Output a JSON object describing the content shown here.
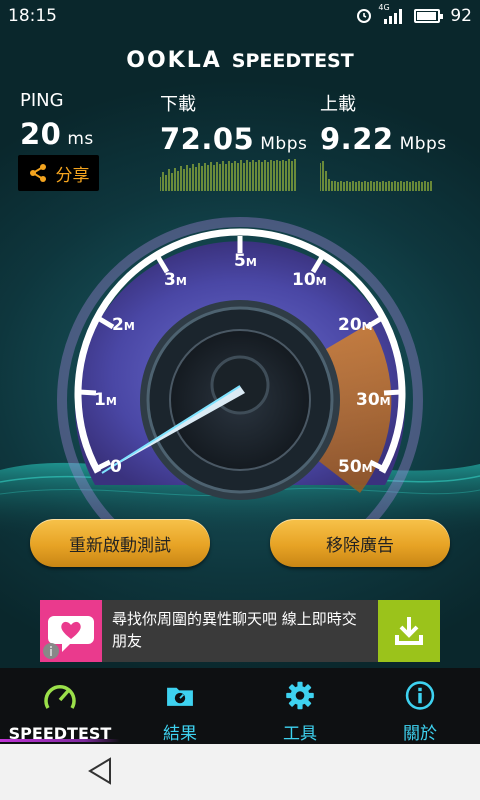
{
  "status": {
    "time": "18:15",
    "network_label": "4G",
    "battery": "92",
    "battery_level": 0.92
  },
  "header": {
    "brand": "OOKLA",
    "product": "SPEEDTEST"
  },
  "stats": {
    "ping": {
      "label": "PING",
      "value": "20",
      "unit": "ms"
    },
    "download": {
      "label": "下載",
      "value": "72.05",
      "unit": "Mbps"
    },
    "upload": {
      "label": "上載",
      "value": "9.22",
      "unit": "Mbps"
    }
  },
  "share": {
    "label": "分享"
  },
  "gauge": {
    "ticks": [
      "0",
      "1",
      "2",
      "3",
      "5",
      "10",
      "20",
      "30",
      "50"
    ],
    "tick_unit": "M",
    "needle_value": 0.5
  },
  "actions": {
    "retest": "重新啟動測試",
    "remove_ads": "移除廣告"
  },
  "ad": {
    "text": "尋找你周圍的異性聊天吧 線上即時交朋友",
    "download_icon": "download-icon"
  },
  "nav": {
    "items": [
      {
        "label": "SPEEDTEST",
        "icon": "gauge-icon"
      },
      {
        "label": "結果",
        "icon": "folder-icon"
      },
      {
        "label": "工具",
        "icon": "gear-icon"
      },
      {
        "label": "關於",
        "icon": "info-icon"
      }
    ]
  },
  "colors": {
    "accent": "#3ed2f0",
    "button": "#e7a325",
    "share_text": "#f4a41f",
    "ad_pink": "#ea3a8d",
    "ad_green": "#9bc31b"
  }
}
